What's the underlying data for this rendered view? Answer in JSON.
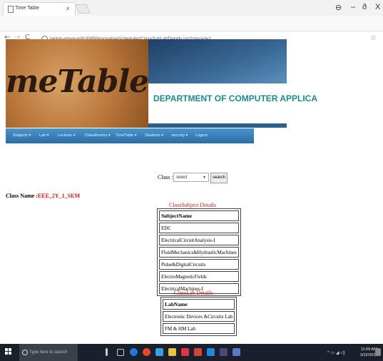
{
  "browser": {
    "tab_title": "Time Table",
    "tab_close": "x",
    "url": "laptop-qmvvun0t:8089/InnovativeScheduler/ClassSubLabDetails.jsp?classid=1",
    "window_controls": [
      "⊖",
      "–",
      "ð",
      "X"
    ],
    "star": "☆"
  },
  "banner": {
    "logo_text": "meTable",
    "department": "DEPARTMENT OF COMPUTER APPLICA"
  },
  "menu": {
    "items": [
      "Subjects ▾",
      "Lab ▾",
      "Lecturer ▾",
      "ClassRooms ▾",
      "TimeTable ▾",
      "Students ▾",
      "security ▾",
      "Logout"
    ]
  },
  "class_form": {
    "label": "Class :",
    "select_value": "select",
    "search_label": "search"
  },
  "class_name": {
    "label": "Class Name :",
    "value": "EEE_2Y_1_SEM"
  },
  "subject_table": {
    "caption": "ClassSubject Details",
    "header": "SubjectName",
    "rows": [
      "EDC",
      "ElectricalCircuitAnalysis-I",
      "FluidMechanics&HydraulicMachines",
      "Pulse&DigitalCircuits",
      "ElectroMagneticFields",
      "ElectricalMachines-I"
    ]
  },
  "lab_table": {
    "caption": "ClassLab Details",
    "header": "LabName",
    "rows": [
      "Electronic Devices &Circuits Lab",
      "FM & HM Lab"
    ]
  },
  "taskbar": {
    "search_placeholder": "Type here to search",
    "time": "11:09 AM",
    "date": "3/22/2018"
  }
}
